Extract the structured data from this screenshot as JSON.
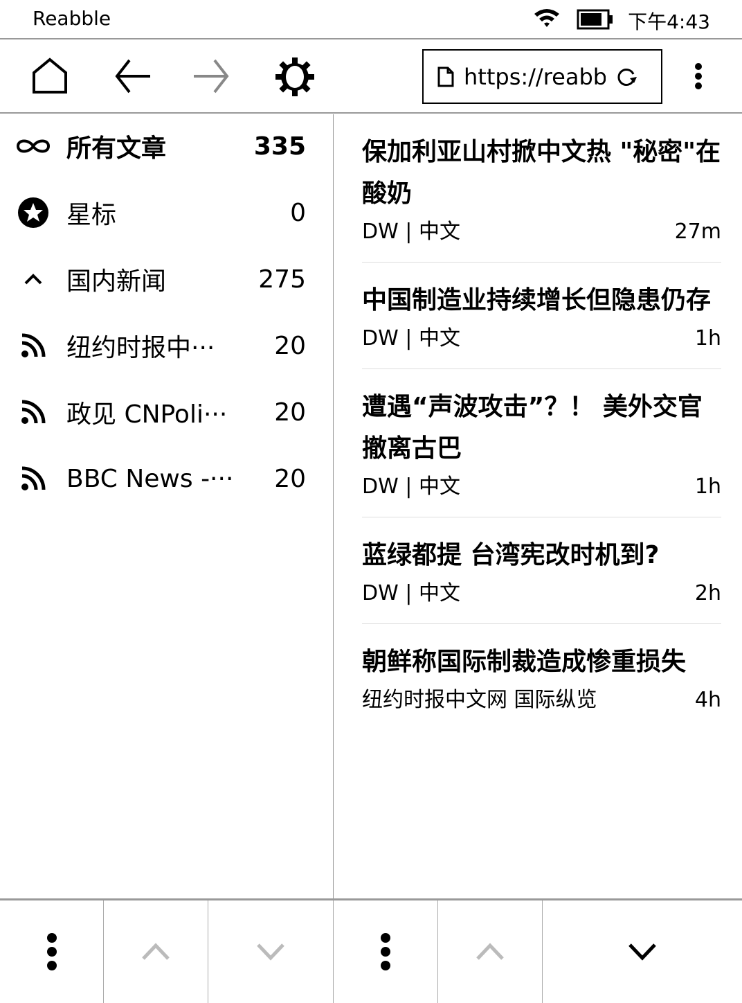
{
  "status": {
    "app_name": "Reabble",
    "time": "下午4:43",
    "icons": [
      "wifi-icon",
      "battery-icon"
    ]
  },
  "toolbar": {
    "url": "https://reabble.cn",
    "icons": [
      "home-icon",
      "back-icon",
      "forward-icon",
      "settings-icon",
      "page-icon",
      "reload-icon",
      "more-icon"
    ]
  },
  "sidebar": {
    "items": [
      {
        "icon": "infinity-icon",
        "label": "所有文章",
        "count": "335",
        "bold": true
      },
      {
        "icon": "star-icon",
        "label": "星标",
        "count": "0"
      },
      {
        "icon": "chevron-up-icon",
        "label": "国内新闻",
        "count": "275"
      },
      {
        "icon": "rss-icon",
        "label": "纽约时报中···",
        "count": "20"
      },
      {
        "icon": "rss-icon",
        "label": "政见 CNPoli···",
        "count": "20"
      },
      {
        "icon": "rss-icon",
        "label": "BBC News -···",
        "count": "20"
      }
    ]
  },
  "articles": [
    {
      "title": "保加利亚山村掀中文热 \"秘密\"在酸奶",
      "source": "DW | 中文",
      "age": "27m"
    },
    {
      "title": "中国制造业持续增长但隐患仍存",
      "source": "DW | 中文",
      "age": "1h"
    },
    {
      "title": "遭遇“声波攻击”？！ 美外交官撤离古巴",
      "source": "DW | 中文",
      "age": "1h"
    },
    {
      "title": "蓝绿都提 台湾宪改时机到?",
      "source": "DW | 中文",
      "age": "2h"
    },
    {
      "title": "朝鲜称国际制裁造成惨重损失",
      "source": "纽约时报中文网 国际纵览",
      "age": "4h"
    }
  ],
  "bottom_bar": {
    "colors": {
      "enabled": "#000000",
      "disabled": "#bbbbbb"
    }
  }
}
